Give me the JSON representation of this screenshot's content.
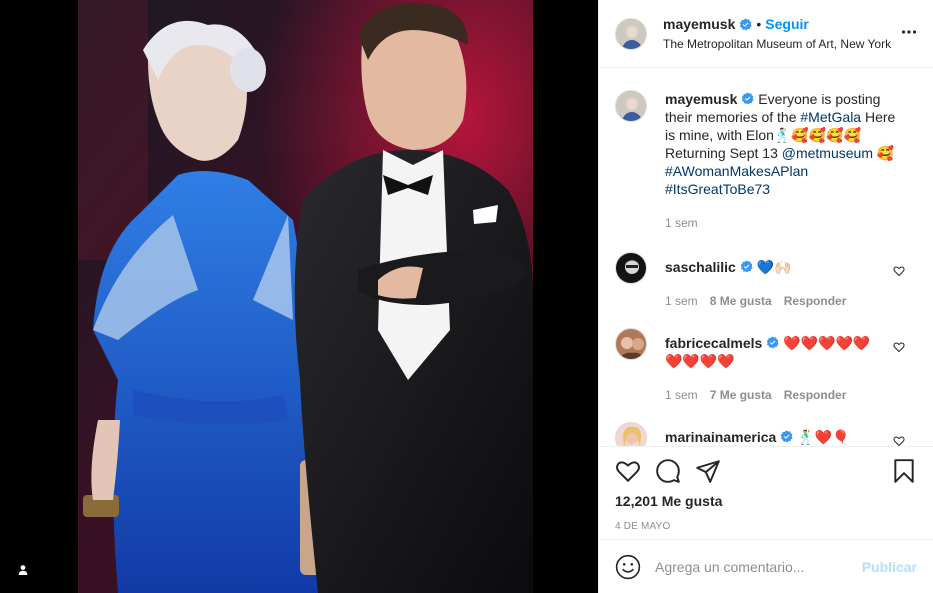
{
  "colors": {
    "accent": "#0095f6",
    "link": "#00376b",
    "muted": "#8e8e8e",
    "verified": "#3897f0",
    "publish_disabled": "#b2dffc"
  },
  "photo": {
    "alt": "photo",
    "tag_icon": "user-tag-icon"
  },
  "header": {
    "username": "mayemusk",
    "separator": "•",
    "follow_label": "Seguir",
    "location": "The Metropolitan Museum of Art, New York",
    "more_icon": "more-horizontal-icon"
  },
  "caption": {
    "username": "mayemusk",
    "text_1": "Everyone is posting their memories of the",
    "hashtag_1": "#MetGala",
    "text_2": "Here is mine, with Elon🕺🏻🥰🥰🥰🥰",
    "text_3": "Returning Sept 13",
    "mention": "@metmuseum",
    "text_4": "🥰",
    "hashtag_2": "#AWomanMakesAPlan",
    "hashtag_3": "#ItsGreatToBe73",
    "time": "1 sem"
  },
  "comments": [
    {
      "username": "saschalilic",
      "text": "💙🙌🏻",
      "time": "1 sem",
      "likes": "8 Me gusta",
      "reply": "Responder"
    },
    {
      "username": "fabricecalmels",
      "text": "❤️❤️❤️❤️❤️❤️❤️❤️❤️",
      "time": "1 sem",
      "likes": "7 Me gusta",
      "reply": "Responder"
    },
    {
      "username": "marinainamerica",
      "text": "🕺❤️🎈"
    }
  ],
  "actions": {
    "like_icon": "heart-icon",
    "comment_icon": "comment-icon",
    "share_icon": "share-icon",
    "save_icon": "bookmark-icon",
    "likes": "12,201 Me gusta",
    "date": "4 DE MAYO"
  },
  "add_comment": {
    "emoji_icon": "emoji-icon",
    "placeholder": "Agrega un comentario...",
    "publish_label": "Publicar"
  }
}
